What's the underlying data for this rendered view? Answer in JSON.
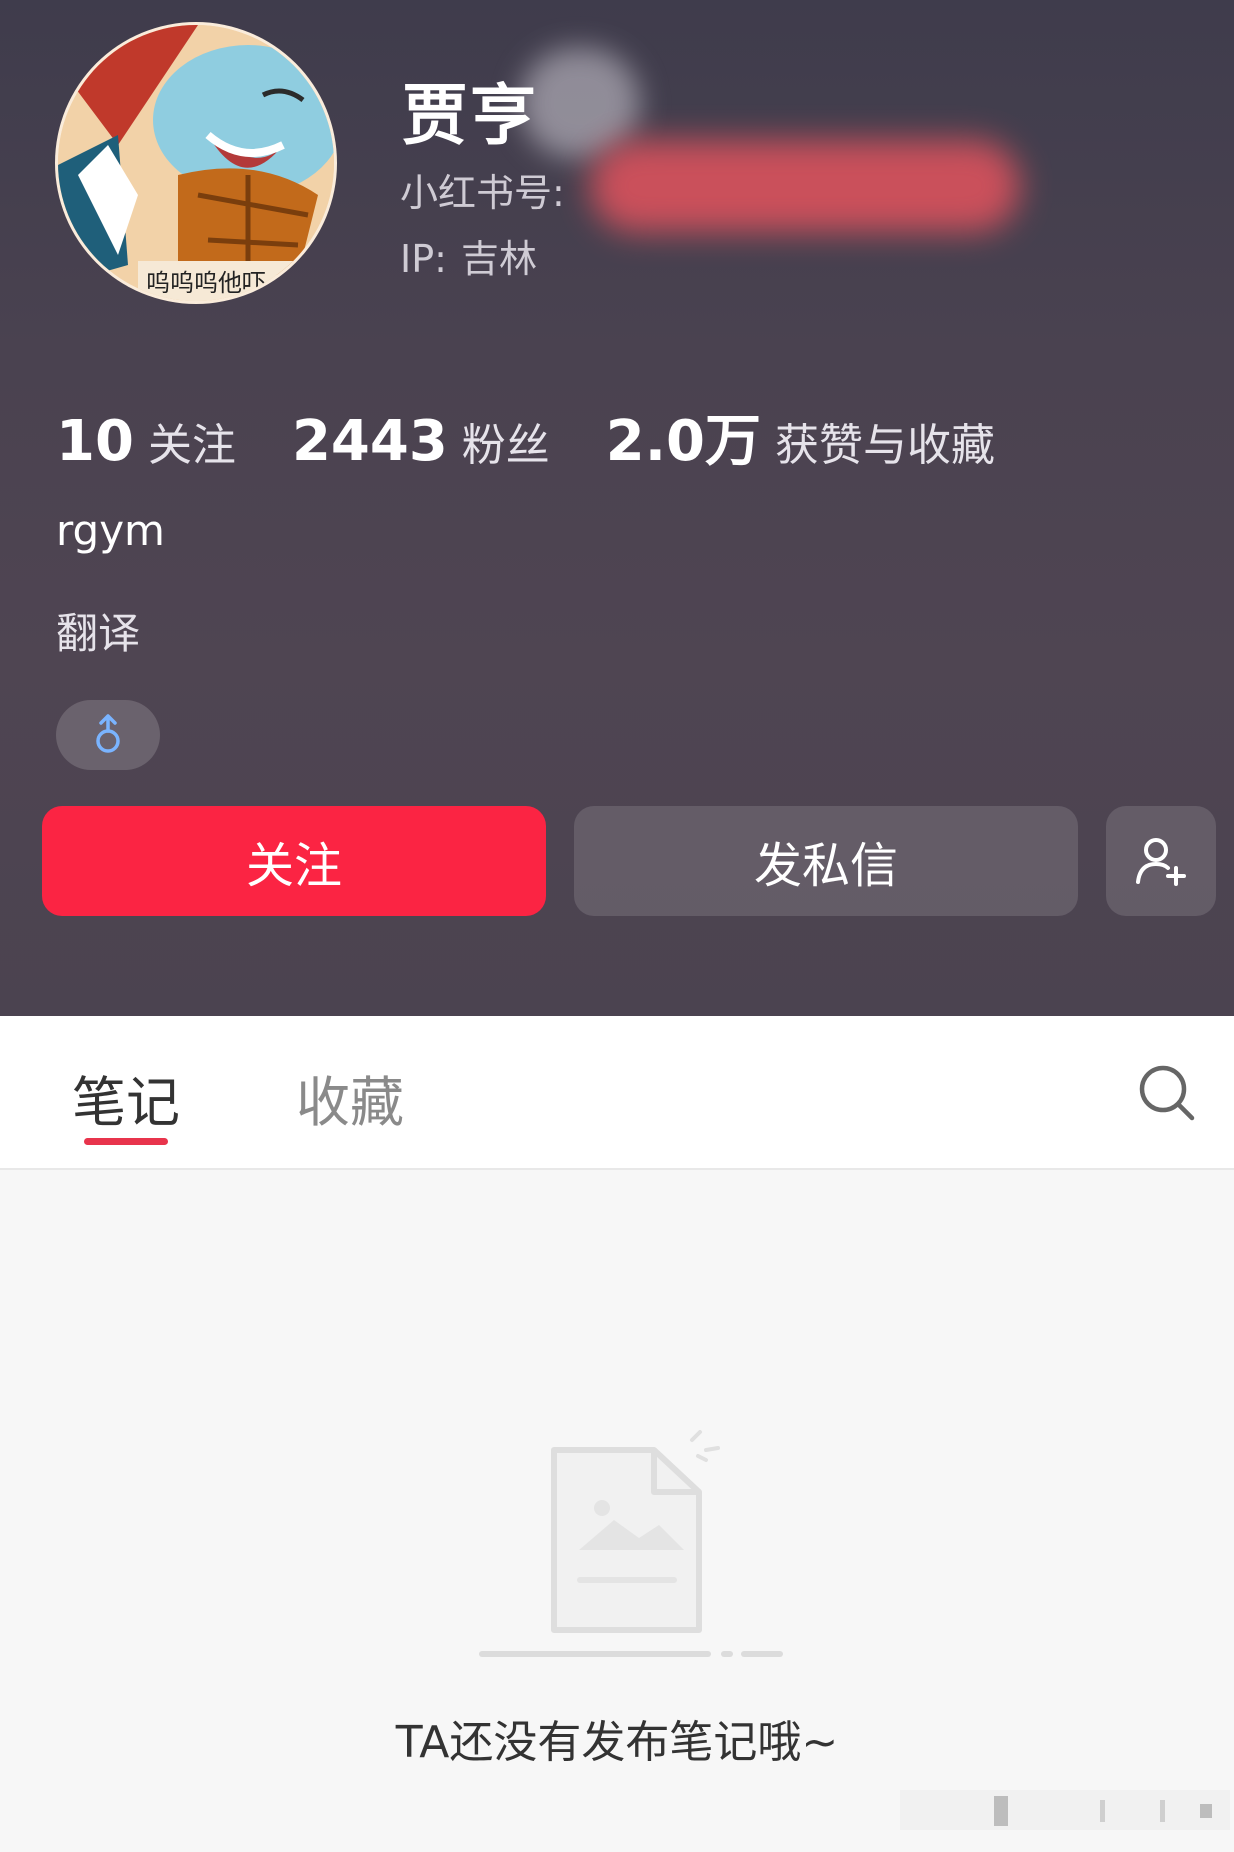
{
  "profile": {
    "name": "贾亨",
    "red_id_label": "小红书号:",
    "ip_label": "IP:",
    "ip_value": "吉林",
    "avatar_caption": "呜呜呜他吓",
    "stats": [
      {
        "value": "10",
        "label": "关注"
      },
      {
        "value": "2443",
        "label": "粉丝"
      },
      {
        "value": "2.0万",
        "label": "获赞与收藏"
      }
    ],
    "bio_line1": "rgym",
    "bio_line2": "翻译",
    "gender_icon": "male-icon"
  },
  "actions": {
    "follow_label": "关注",
    "message_label": "发私信",
    "add_friend_icon": "add-user-icon"
  },
  "tabs": [
    {
      "label": "笔记",
      "active": true
    },
    {
      "label": "收藏",
      "active": false
    }
  ],
  "search_icon": "search-icon",
  "empty_state": {
    "message": "TA还没有发布笔记哦~"
  },
  "colors": {
    "accent": "#fb2443",
    "tab_underline": "#e8344c"
  }
}
